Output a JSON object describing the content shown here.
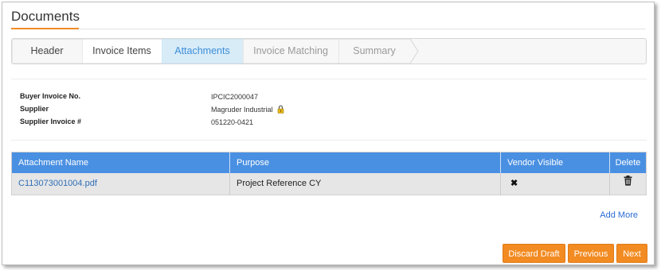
{
  "page": {
    "title": "Documents"
  },
  "wizard": {
    "steps": [
      {
        "label": "Header",
        "state": "done"
      },
      {
        "label": "Invoice Items",
        "state": "done"
      },
      {
        "label": "Attachments",
        "state": "active"
      },
      {
        "label": "Invoice Matching",
        "state": "disabled"
      },
      {
        "label": "Summary",
        "state": "disabled"
      }
    ]
  },
  "info": {
    "buyer_invoice_label": "Buyer Invoice No.",
    "buyer_invoice_value": "IPCIC2000047",
    "supplier_label": "Supplier",
    "supplier_value": "Magruder Industrial",
    "supplier_icon": "lock-icon",
    "supplier_invoice_label": "Supplier Invoice #",
    "supplier_invoice_value": "051220-0421"
  },
  "table": {
    "headers": [
      "Attachment Name",
      "Purpose",
      "Vendor Visible",
      "Delete"
    ],
    "rows": [
      {
        "name": "C113073001004.pdf",
        "purpose": "Project Reference CY",
        "vendor_visible": "✖",
        "delete_icon": "trash-icon"
      }
    ]
  },
  "add_more_label": "Add More",
  "buttons": {
    "discard": "Discard Draft",
    "previous": "Previous",
    "next": "Next"
  },
  "colors": {
    "accent_orange": "#f28b22",
    "header_blue": "#4a90e2",
    "active_step": "#3d8ed8",
    "link": "#2f6fb8"
  }
}
